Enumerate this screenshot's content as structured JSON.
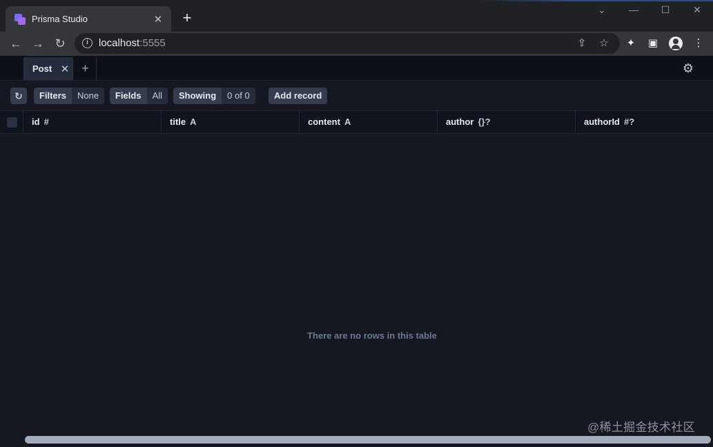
{
  "browser": {
    "tab_title": "Prisma Studio",
    "tab_close": "✕",
    "new_tab": "+",
    "window_controls": {
      "menu": "⌄",
      "minimize": "—",
      "maximize": "☐",
      "close": "✕"
    },
    "url_host": "localhost",
    "url_port": ":5555",
    "icons": [
      "back-icon",
      "forward-icon",
      "reload-icon",
      "info-icon",
      "share-icon",
      "star-icon",
      "extensions-icon",
      "side-panel-icon",
      "profile-icon",
      "menu-icon"
    ]
  },
  "studio": {
    "tabs": [
      {
        "label": "Post"
      }
    ],
    "tab_close": "✕",
    "add_tab": "+",
    "toolbar": {
      "filters_label": "Filters",
      "filters_value": "None",
      "fields_label": "Fields",
      "fields_value": "All",
      "showing_label": "Showing",
      "showing_value": "0 of 0",
      "add_record_label": "Add record"
    },
    "columns": [
      {
        "name": "id",
        "type": "#"
      },
      {
        "name": "title",
        "type": "A"
      },
      {
        "name": "content",
        "type": "A"
      },
      {
        "name": "author",
        "type": "{}?"
      },
      {
        "name": "authorId",
        "type": "#?"
      }
    ],
    "empty_message": "There are no rows in this table"
  },
  "watermark": "@稀土掘金技术社区"
}
